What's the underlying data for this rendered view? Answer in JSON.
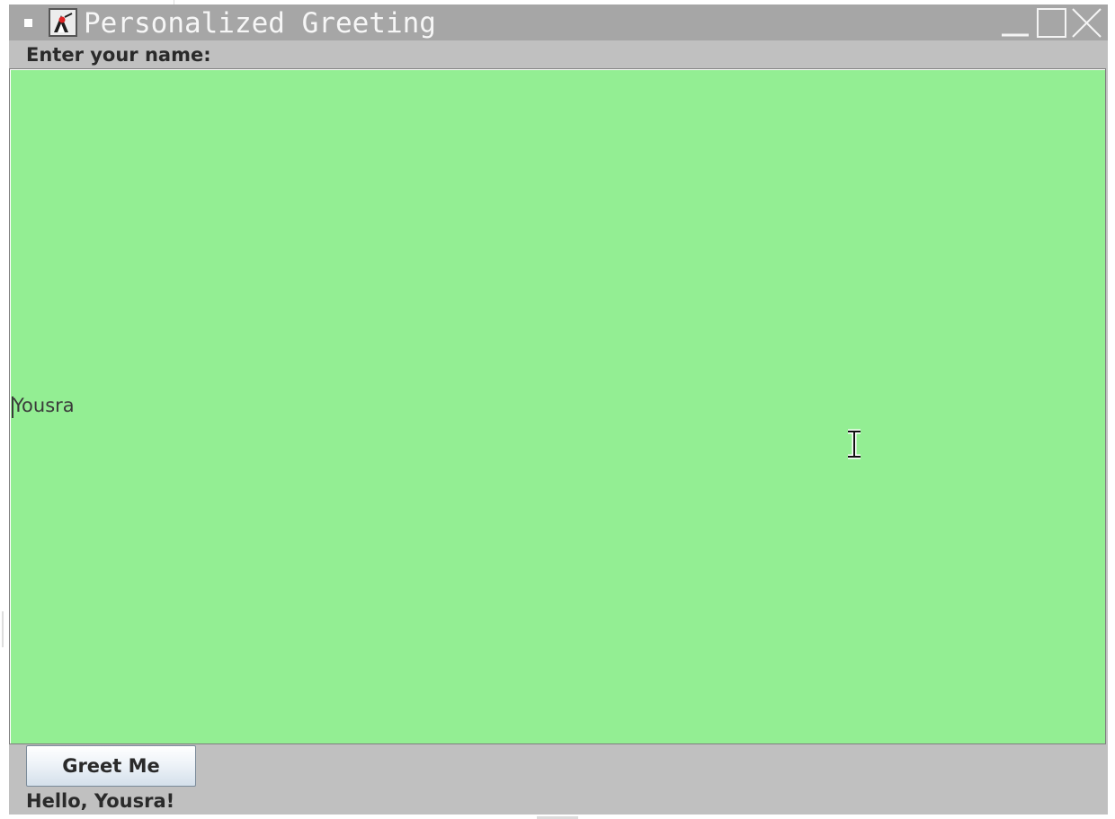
{
  "window": {
    "title": "Personalized Greeting",
    "icon": "java-duke-icon"
  },
  "title_controls": {
    "system_menu": "system-menu-icon",
    "minimize": "minimize-icon",
    "maximize": "maximize-icon",
    "close": "close-icon"
  },
  "form": {
    "prompt_label": "Enter your name:",
    "name_value": "Yousra",
    "button_label": "Greet Me",
    "greeting_output": "Hello, Yousra!"
  },
  "colors": {
    "text_area_background": "#93ee93",
    "window_background": "#c0c0c0",
    "title_bar": "#a6a6a6"
  }
}
